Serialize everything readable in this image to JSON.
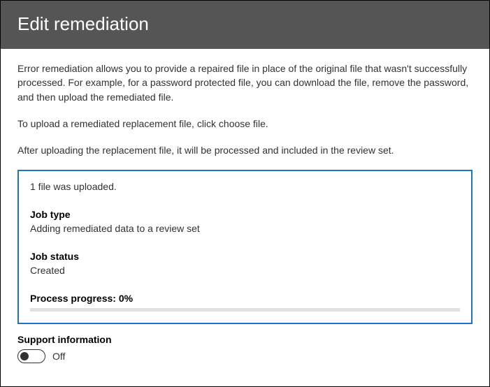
{
  "header": {
    "title": "Edit remediation"
  },
  "body": {
    "description1": "Error remediation allows you to provide a repaired file in place of the original file that wasn't successfully processed. For example, for a password protected file, you can download the file, remove the password, and then upload the remediated file.",
    "description2": "To upload a remediated replacement file, click choose file.",
    "description3": "After uploading the replacement file, it will be processed and included in the review set."
  },
  "status": {
    "upload_message": "1 file was uploaded.",
    "job_type_label": "Job type",
    "job_type_value": "Adding remediated data to a review set",
    "job_status_label": "Job status",
    "job_status_value": "Created",
    "progress_label": "Process progress: 0%",
    "progress_percent": 0
  },
  "support": {
    "label": "Support information",
    "toggle_state": "Off"
  }
}
